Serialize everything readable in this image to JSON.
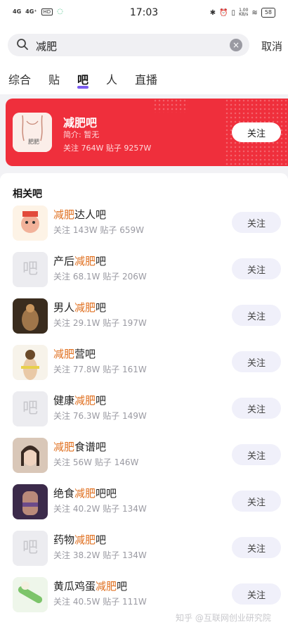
{
  "status_bar": {
    "signal1": "4G",
    "signal2": "4G⁺",
    "hd": "HD",
    "time": "17:03",
    "speed_value": "1.00",
    "speed_unit": "KB/s",
    "battery": "58"
  },
  "search": {
    "query": "减肥",
    "cancel_label": "取消"
  },
  "tabs": [
    {
      "label": "综合"
    },
    {
      "label": "贴"
    },
    {
      "label": "吧"
    },
    {
      "label": "人"
    },
    {
      "label": "直播"
    }
  ],
  "active_tab": "吧",
  "featured": {
    "title": "减肥吧",
    "intro": "简介: 暂无",
    "stats": "关注 764W   贴子 9257W",
    "follow_label": "关注",
    "avatar_caption": "肥肥"
  },
  "related": {
    "title": "相关吧",
    "follow_label": "关注",
    "placeholder_glyph": "吧",
    "items": [
      {
        "prefix": "",
        "highlight": "减肥",
        "suffix": "达人吧",
        "stats": "关注 143W 贴子 659W",
        "avatar": "image"
      },
      {
        "prefix": "产后",
        "highlight": "减肥",
        "suffix": "吧",
        "stats": "关注 68.1W 贴子 206W",
        "avatar": "placeholder"
      },
      {
        "prefix": "男人",
        "highlight": "减肥",
        "suffix": "吧",
        "stats": "关注 29.1W 贴子 197W",
        "avatar": "image"
      },
      {
        "prefix": "",
        "highlight": "减肥",
        "suffix": "营吧",
        "stats": "关注 77.8W 贴子 161W",
        "avatar": "image"
      },
      {
        "prefix": "健康",
        "highlight": "减肥",
        "suffix": "吧",
        "stats": "关注 76.3W 贴子 149W",
        "avatar": "placeholder"
      },
      {
        "prefix": "",
        "highlight": "减肥",
        "suffix": "食谱吧",
        "stats": "关注 56W 贴子 146W",
        "avatar": "image"
      },
      {
        "prefix": "绝食",
        "highlight": "减肥",
        "suffix": "吧吧",
        "stats": "关注 40.2W 贴子 134W",
        "avatar": "image"
      },
      {
        "prefix": "药物",
        "highlight": "减肥",
        "suffix": "吧",
        "stats": "关注 38.2W 贴子 134W",
        "avatar": "placeholder"
      },
      {
        "prefix": "黄瓜鸡蛋",
        "highlight": "减肥",
        "suffix": "吧",
        "stats": "关注 40.5W 贴子 111W",
        "avatar": "image"
      }
    ]
  },
  "watermark": "知乎 @互联网创业研究院",
  "colors": {
    "featured_bg": "#ef2f3c",
    "highlight": "#e07020",
    "tab_indicator": "#7b5cf0",
    "follow_bg": "#f0f0fa"
  }
}
